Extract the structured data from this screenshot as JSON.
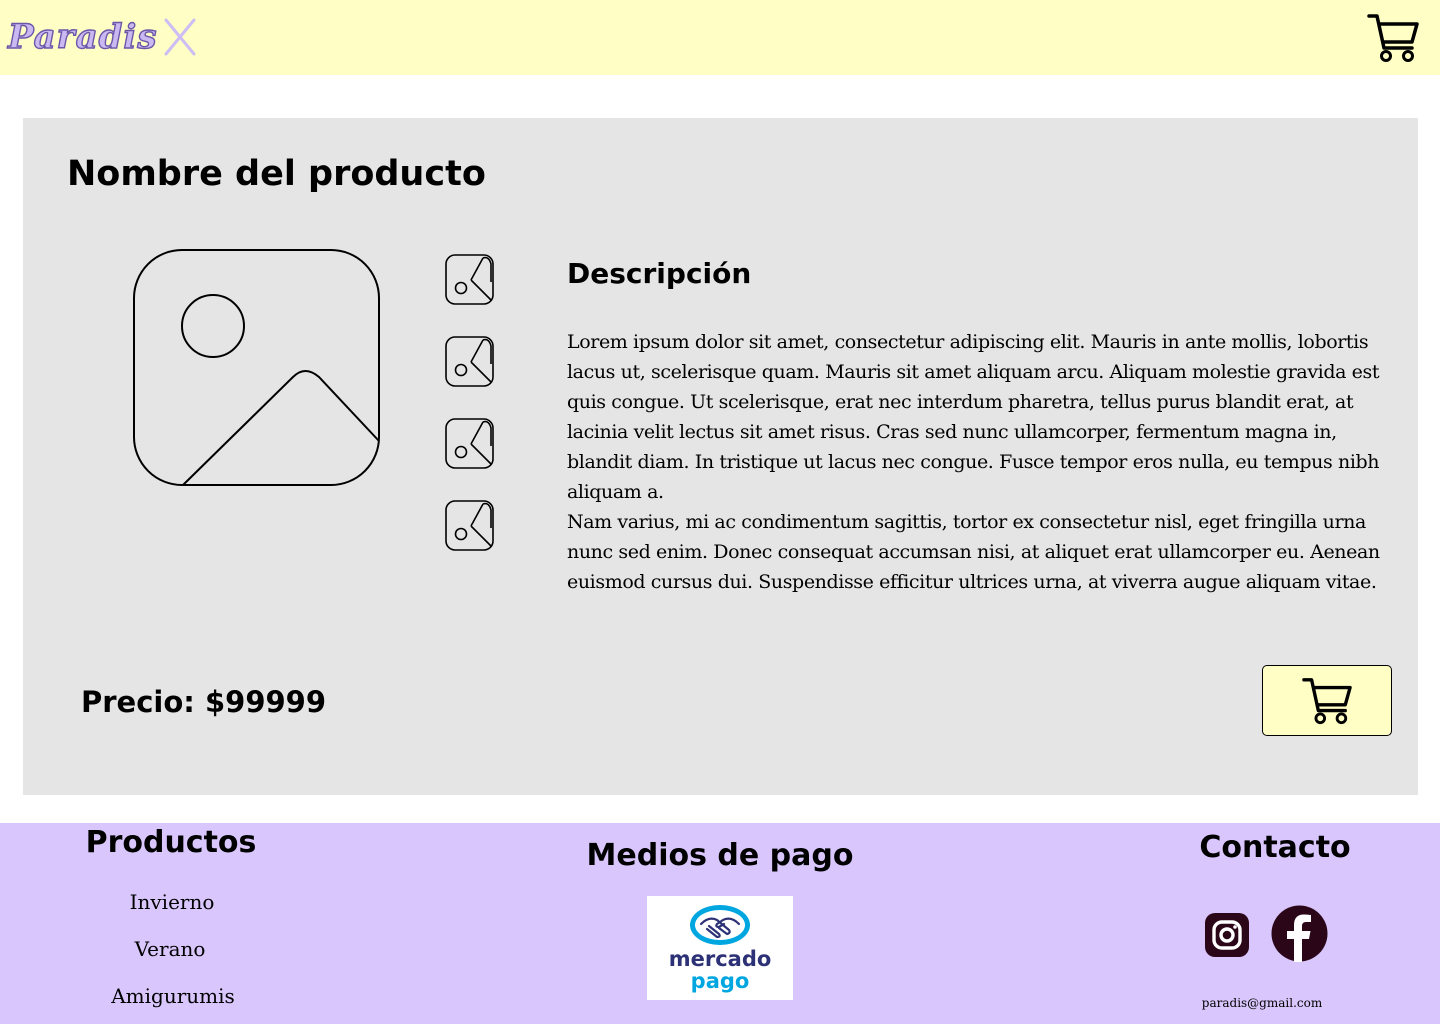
{
  "header": {
    "logo_text": "Paradis",
    "logo_icon": "x-mark-icon",
    "cart_icon": "shopping-cart-icon"
  },
  "product": {
    "title": "Nombre del producto",
    "main_image_icon": "image-placeholder-icon",
    "thumbnail_icon": "image-placeholder-icon",
    "thumbnail_count": 4,
    "description_title": "Descripción",
    "description_paragraphs": [
      "Lorem ipsum dolor sit amet, consectetur adipiscing elit. Mauris in ante mollis, lobortis lacus ut, scelerisque quam. Mauris sit amet aliquam arcu. Aliquam molestie gravida est quis congue. Ut scelerisque, erat nec interdum pharetra, tellus purus blandit erat, at lacinia velit lectus sit amet risus. Cras sed nunc ullamcorper, fermentum magna in, blandit diam. In tristique ut lacus nec congue. Fusce tempor eros nulla, eu tempus nibh aliquam a.",
      "Nam varius, mi ac condimentum sagittis, tortor ex consectetur nisl, eget fringilla urna nunc sed enim. Donec consequat accumsan nisi, at aliquet erat ullamcorper eu. Aenean euismod cursus dui. Suspendisse efficitur ultrices urna, at viverra augue aliquam vitae."
    ],
    "price_text": "Precio: $99999",
    "add_to_cart_icon": "shopping-cart-icon"
  },
  "footer": {
    "products_heading": "Productos",
    "product_links": [
      "Invierno",
      "Verano",
      "Amigurumis"
    ],
    "payment_heading": "Medios de pago",
    "payment_logo_line1": "mercado",
    "payment_logo_line2": "pago",
    "contact_heading": "Contacto",
    "social_icons": [
      "instagram-icon",
      "facebook-icon"
    ],
    "email": "paradis@gmail.com"
  },
  "colors": {
    "header_bg": "#ffffc5",
    "card_bg": "#e5e5e5",
    "footer_bg": "#d9c6fd",
    "logo_fill": "#c9b8f2",
    "logo_stroke": "#6a57a8",
    "social_icon": "#2a0618",
    "mercadopago_blue": "#00a6e0",
    "mercadopago_navy": "#2d3277"
  }
}
